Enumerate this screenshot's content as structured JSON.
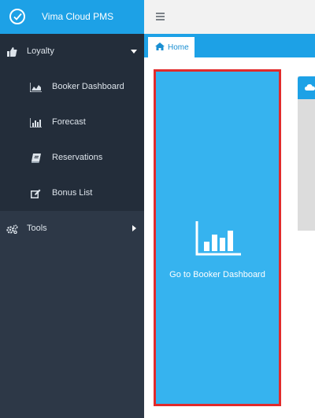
{
  "app": {
    "title": "Vima Cloud PMS"
  },
  "sidebar": {
    "items": [
      {
        "label": "Loyalty",
        "icon": "thumbs-up-icon",
        "expanded": true
      },
      {
        "label": "Booker Dashboard",
        "icon": "area-chart-icon"
      },
      {
        "label": "Forecast",
        "icon": "bar-chart-icon"
      },
      {
        "label": "Reservations",
        "icon": "book-icon"
      },
      {
        "label": "Bonus List",
        "icon": "edit-icon"
      },
      {
        "label": "Tools",
        "icon": "gears-icon",
        "expanded": false
      }
    ]
  },
  "tabs": [
    {
      "label": "Home",
      "icon": "home-icon"
    }
  ],
  "main": {
    "card": {
      "label": "Go to Booker Dashboard",
      "icon": "bar-chart-icon"
    }
  },
  "colors": {
    "accent": "#1da1e6",
    "sidebar": "#2d3847",
    "card": "#36b3ef",
    "highlight": "#e22b2b"
  }
}
